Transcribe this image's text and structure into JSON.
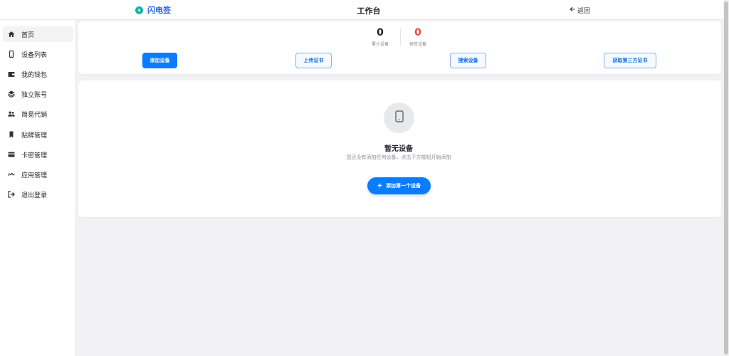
{
  "header": {
    "brand": "闪电签",
    "title": "工作台",
    "back_label": "返回"
  },
  "sidebar": {
    "items": [
      {
        "label": "首页",
        "icon": "home-icon"
      },
      {
        "label": "设备列表",
        "icon": "phone-icon"
      },
      {
        "label": "我的钱包",
        "icon": "wallet-icon"
      },
      {
        "label": "独立账号",
        "icon": "layers-icon"
      },
      {
        "label": "简易代销",
        "icon": "users-icon"
      },
      {
        "label": "贴牌管理",
        "icon": "bookmark-icon"
      },
      {
        "label": "卡密管理",
        "icon": "card-icon"
      },
      {
        "label": "应用管理",
        "icon": "signature-icon"
      },
      {
        "label": "退出登录",
        "icon": "logout-icon"
      }
    ]
  },
  "stats": {
    "total_devices": {
      "value": "0",
      "label": "累计设备",
      "color": "#1f2329"
    },
    "dropped_devices": {
      "value": "0",
      "label": "掉签设备",
      "color": "#e5483f"
    }
  },
  "actions": {
    "add_device": "添加设备",
    "upload_cert": "上传证书",
    "search_device": "搜索设备",
    "third_party_cert": "获取第三方证书"
  },
  "empty_state": {
    "title": "暂无设备",
    "description": "您还没有添加任何设备，点击下方按钮开始添加",
    "button_label": "添加第一个设备"
  },
  "colors": {
    "primary": "#0a7cff",
    "brand_text": "#2563eb",
    "brand_icon": "#17b3a3",
    "danger": "#e5483f"
  }
}
